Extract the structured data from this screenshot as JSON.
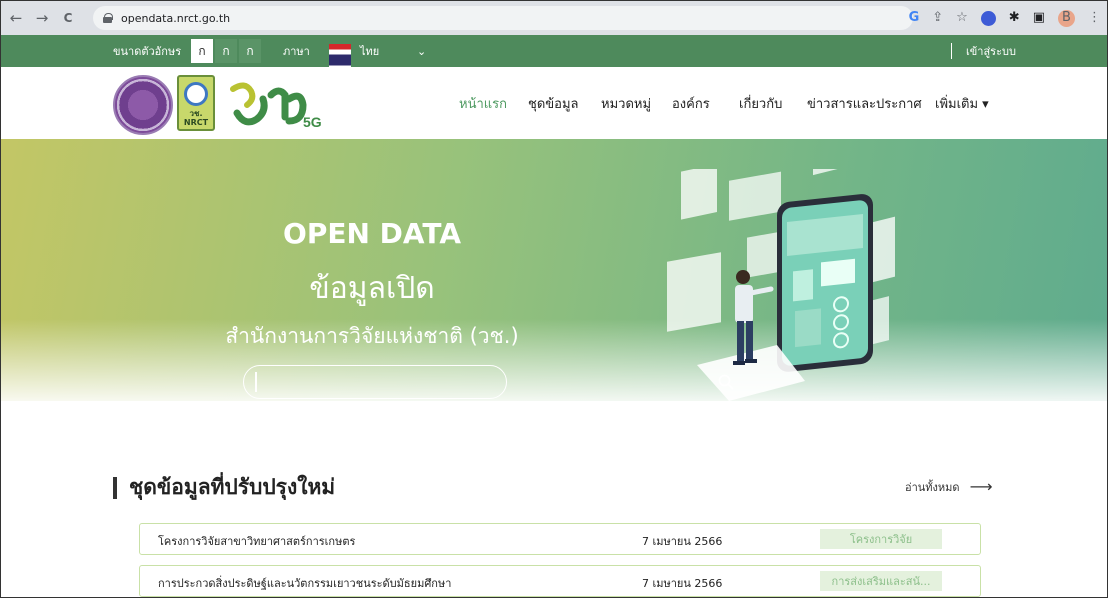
{
  "browser": {
    "url": "opendata.nrct.go.th",
    "back": "←",
    "forward": "→",
    "reload": "C",
    "icons": [
      "google-icon",
      "share-icon",
      "star-icon",
      "extension-icon",
      "puzzle-icon",
      "sidebar-icon",
      "profile-avatar",
      "menu-icon"
    ],
    "profile_initial": "B"
  },
  "utility": {
    "font_size_label": "ขนาดตัวอักษร",
    "font_sizes": [
      "ก",
      "ก",
      "ก"
    ],
    "language_label": "ภาษา",
    "language_value": "ไทย",
    "login_label": "เข้าสู่ระบบ"
  },
  "header": {
    "logo_text": "วช.\nNRCT",
    "nav": [
      "หน้าแรก",
      "ชุดข้อมูล",
      "หมวดหมู่",
      "องค์กร",
      "เกี่ยวกับ",
      "ข่าวสารและประกาศ",
      "เพิ่มเติม ▾"
    ]
  },
  "hero": {
    "title_en": "OPEN DATA",
    "title_th": "ข้อมูลเปิด",
    "subtitle": "สำนักงานการวิจัยแห่งชาติ (วช.)",
    "search_placeholder": ""
  },
  "recent": {
    "title": "ชุดข้อมูลที่ปรับปรุงใหม่",
    "read_all": "อ่านทั้งหมด",
    "read_all_arrow": "⟶",
    "rows": [
      {
        "title": "โครงการวิจัยสาขาวิทยาศาสตร์การเกษตร",
        "date": "7 เมษายน 2566",
        "badge": "โครงการวิจัย"
      },
      {
        "title": "การประกวดสิ่งประดิษฐ์และนวัตกรรมเยาวชนระดับมัธยมศึกษา",
        "date": "7 เมษายน 2566",
        "badge": "การส่งเสริมและสนั..."
      }
    ]
  },
  "colors": {
    "utility_bar": "#4e8a5c",
    "accent_green": "#4e9a61",
    "badge_bg": "#e4f1dd",
    "badge_text": "#8cbf8a"
  }
}
